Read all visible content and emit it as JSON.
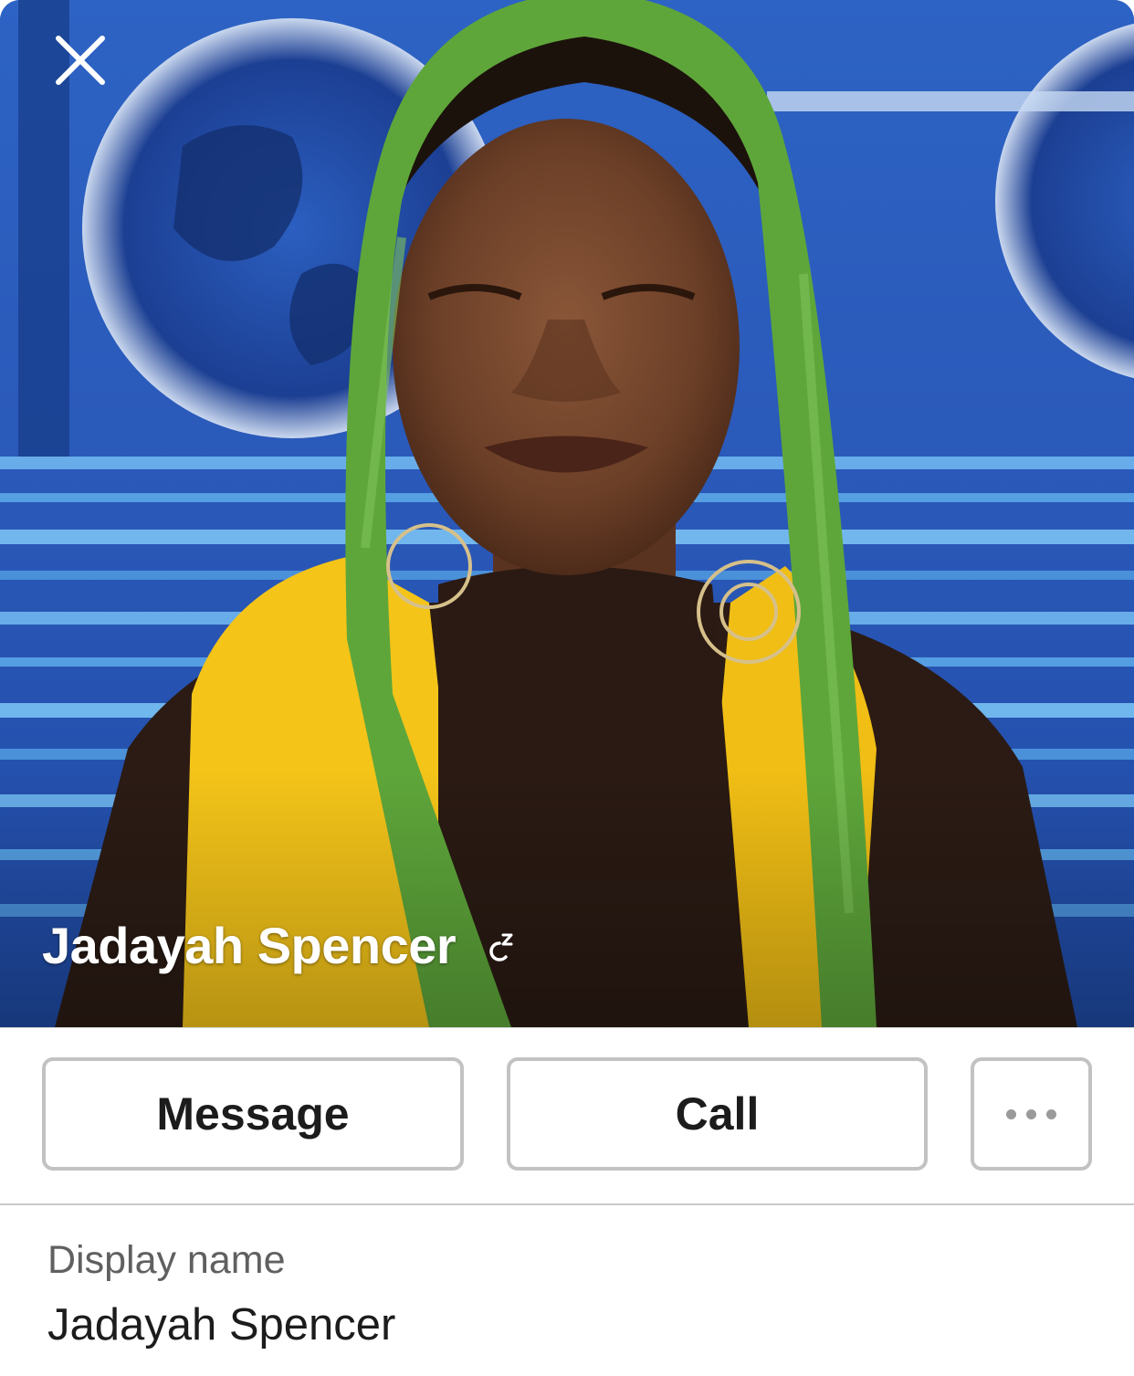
{
  "profile": {
    "name": "Jadayah Spencer",
    "status_icon": "zzz-snooze-icon"
  },
  "actions": {
    "message_label": "Message",
    "call_label": "Call",
    "more_icon": "more-horizontal-icon"
  },
  "fields": {
    "display_name_label": "Display name",
    "display_name_value": "Jadayah Spencer"
  },
  "colors": {
    "background_blue": "#2a58b8",
    "scarf_yellow": "#f4c419",
    "scarf_green": "#5ea63a",
    "text_primary": "#1d1c1d",
    "text_secondary": "#616061",
    "button_border": "#c2c2c2"
  }
}
